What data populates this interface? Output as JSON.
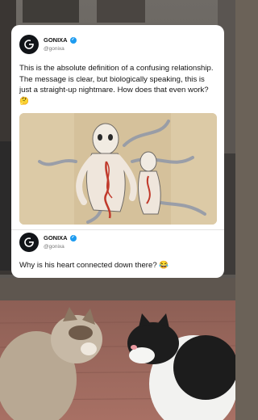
{
  "post1": {
    "username": "GONIXA",
    "handle": "@gonixa",
    "text": "This is the absolute definition of a confusing relationship. The message is clear, but biologically speaking, this is just a straight-up nightmare. How does that even work? 🤔"
  },
  "post2": {
    "username": "GONIXA",
    "handle": "@gonixa",
    "text": "Why is his heart connected down there? 😂"
  },
  "colors": {
    "verified": "#1d9bf0",
    "avatar": "#111418",
    "card": "#ffffff"
  }
}
